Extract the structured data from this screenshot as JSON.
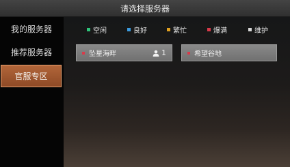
{
  "header": {
    "title": "请选择服务器"
  },
  "sidebar": {
    "items": [
      {
        "label": "我的服务器"
      },
      {
        "label": "推荐服务器"
      },
      {
        "label": "官服专区",
        "selected": true
      }
    ]
  },
  "legend": [
    {
      "label": "空闲",
      "color": "#2ec47a"
    },
    {
      "label": "良好",
      "color": "#3b9be0"
    },
    {
      "label": "繁忙",
      "color": "#e0a020"
    },
    {
      "label": "爆满",
      "color": "#d83a4a"
    },
    {
      "label": "维护",
      "color": "#d8d8d8"
    }
  ],
  "servers": [
    {
      "name": "坠星海畔",
      "status_color": "#d83a4a",
      "icon": "person-icon",
      "count": "1"
    },
    {
      "name": "希望谷地",
      "status_color": "#d83a4a"
    }
  ],
  "colors": {
    "accent": "#b2663a",
    "accent_border": "#e6a271",
    "card": "#7c7c7c"
  }
}
